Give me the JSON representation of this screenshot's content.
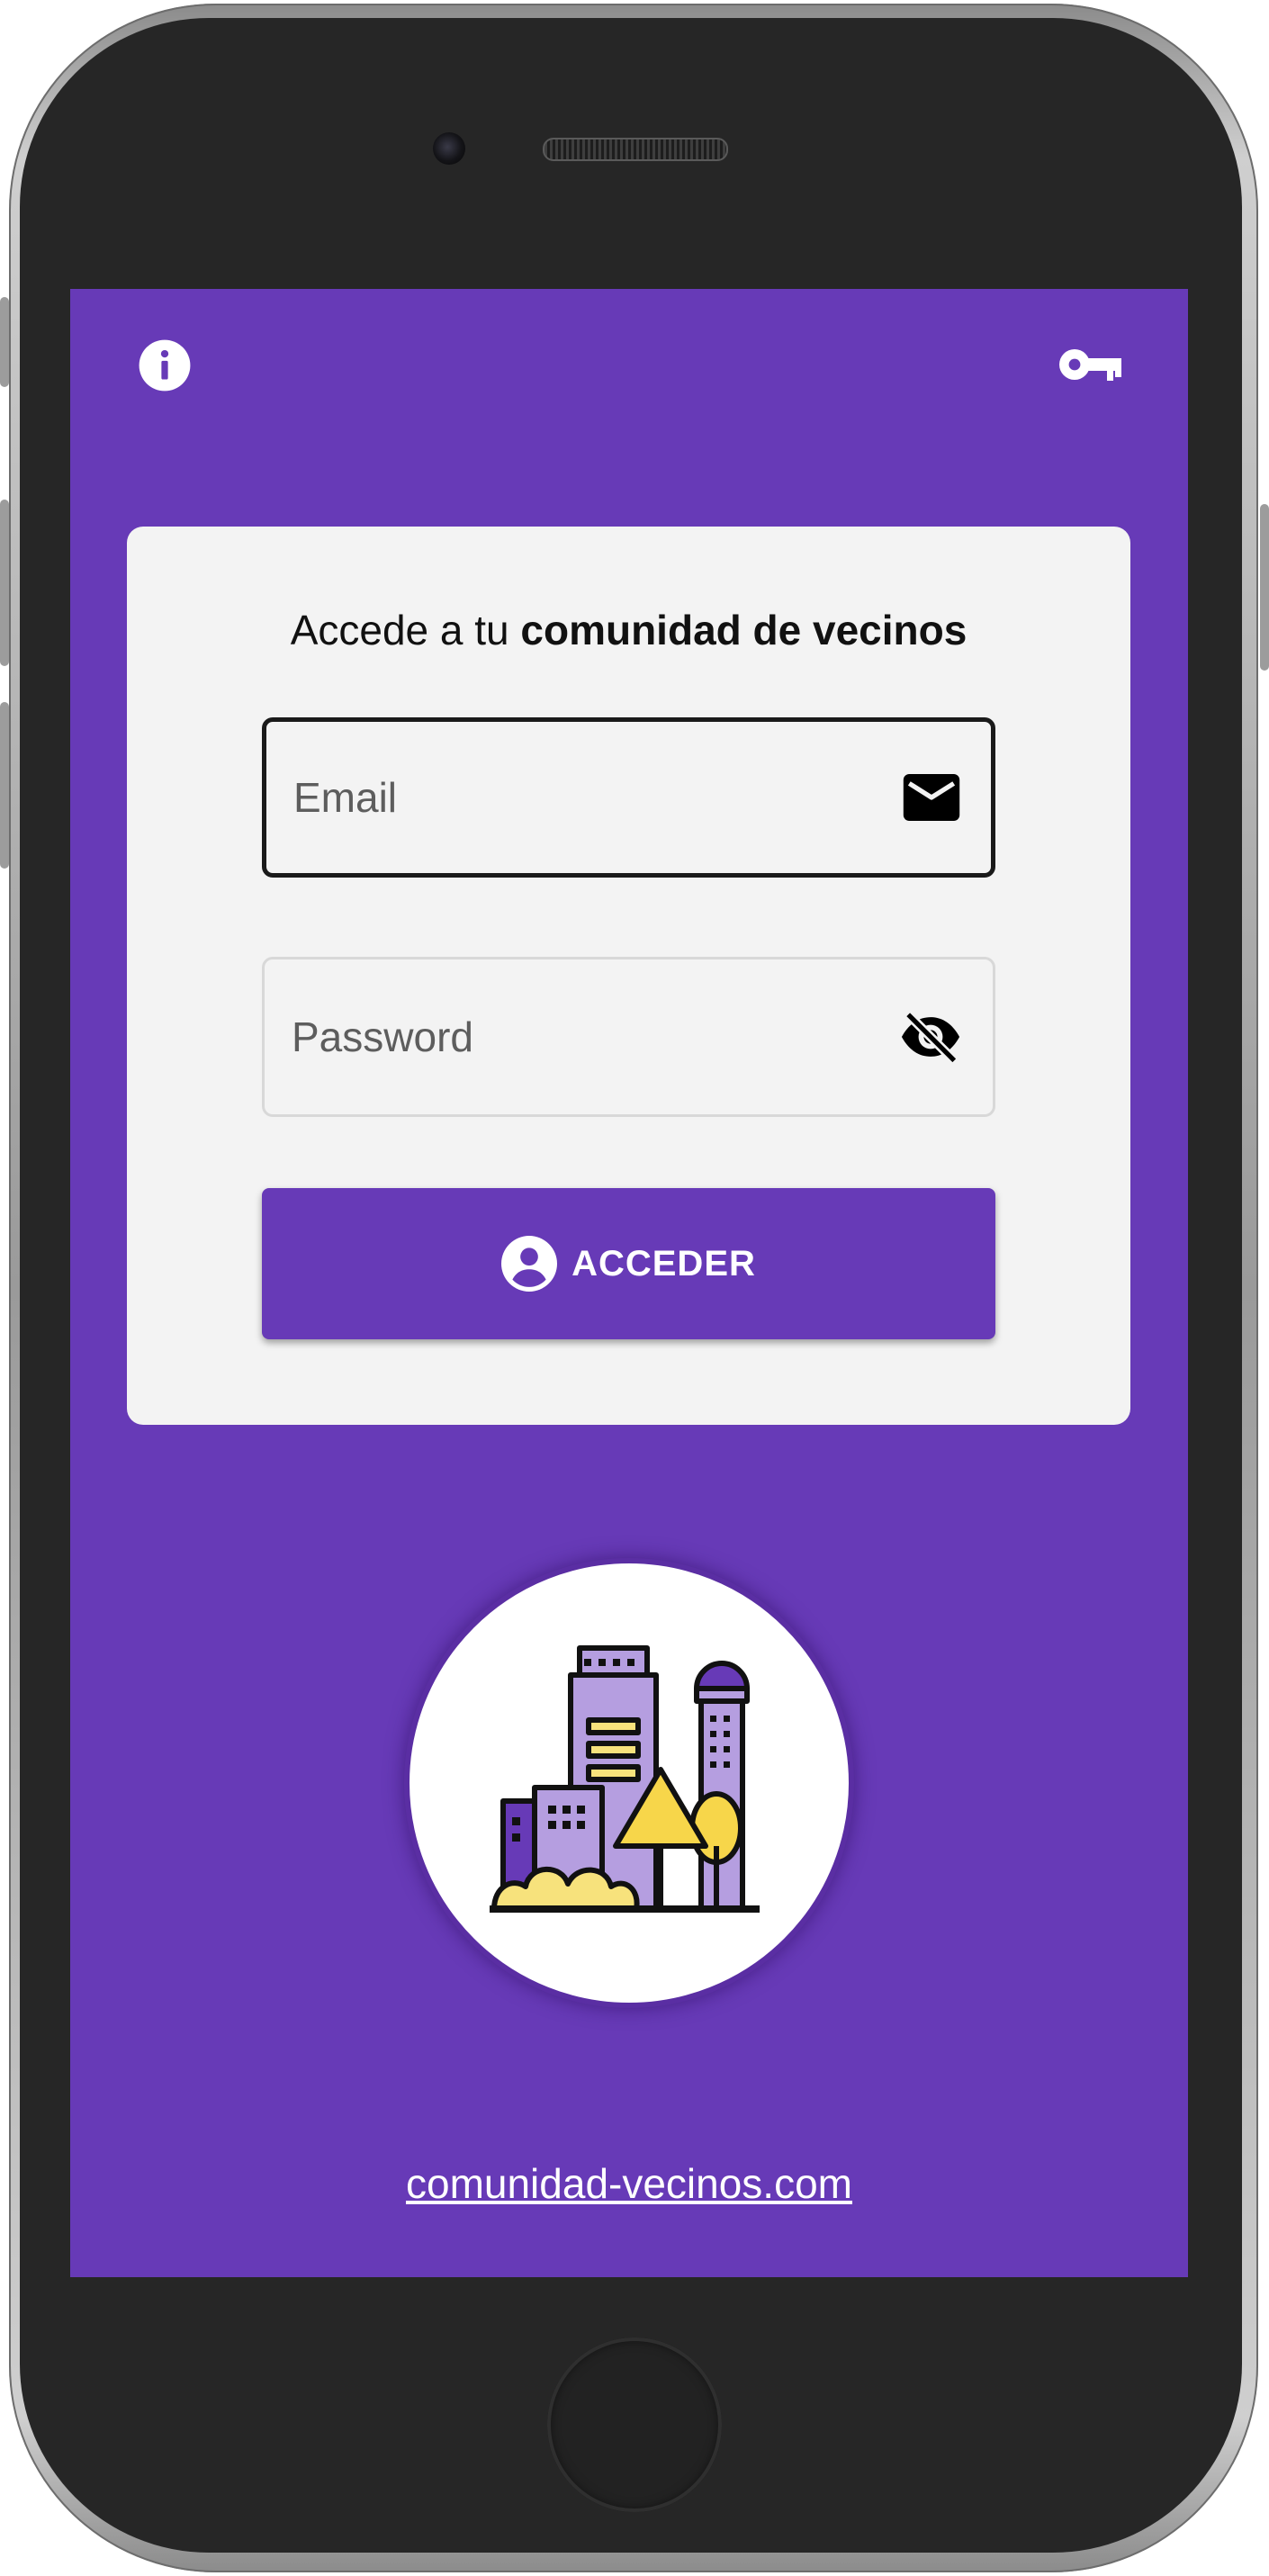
{
  "header": {
    "info_icon": "info-icon",
    "key_icon": "key-icon"
  },
  "login": {
    "title_prefix": "Accede a tu",
    "title_bold": "comunidad de vecinos",
    "email_placeholder": "Email",
    "email_icon": "envelope-icon",
    "password_placeholder": "Password",
    "password_icon": "eye-off-icon",
    "submit_label": "ACCEDER",
    "submit_icon": "account-circle-icon"
  },
  "logo": {
    "icon": "city-buildings-icon"
  },
  "footer": {
    "link_text": "comunidad-vecinos.com"
  },
  "colors": {
    "brand": "#673ab7",
    "card": "#f3f3f3",
    "text": "#111111",
    "white": "#ffffff",
    "accent_yellow": "#f7e27c",
    "building_purple": "#b59ee0"
  }
}
